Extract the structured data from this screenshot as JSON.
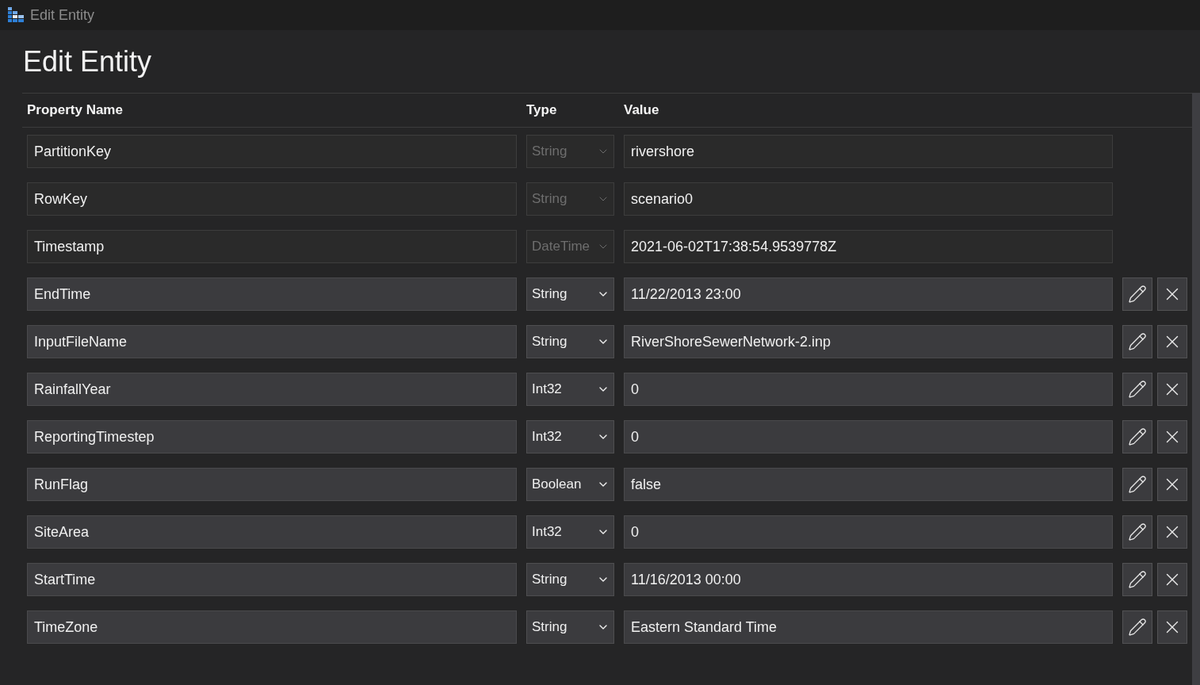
{
  "window": {
    "title": "Edit Entity"
  },
  "heading": "Edit Entity",
  "table": {
    "columns": [
      "Property Name",
      "Type",
      "Value"
    ],
    "rows": [
      {
        "name": "PartitionKey",
        "type": "String",
        "value": "rivershore",
        "disabled": true
      },
      {
        "name": "RowKey",
        "type": "String",
        "value": "scenario0",
        "disabled": true
      },
      {
        "name": "Timestamp",
        "type": "DateTime",
        "value": "2021-06-02T17:38:54.9539778Z",
        "disabled": true
      },
      {
        "name": "EndTime",
        "type": "String",
        "value": "11/22/2013 23:00",
        "disabled": false
      },
      {
        "name": "InputFileName",
        "type": "String",
        "value": "RiverShoreSewerNetwork-2.inp",
        "disabled": false
      },
      {
        "name": "RainfallYear",
        "type": "Int32",
        "value": "0",
        "disabled": false
      },
      {
        "name": "ReportingTimestep",
        "type": "Int32",
        "value": "0",
        "disabled": false
      },
      {
        "name": "RunFlag",
        "type": "Boolean",
        "value": "false",
        "disabled": false
      },
      {
        "name": "SiteArea",
        "type": "Int32",
        "value": "0",
        "disabled": false
      },
      {
        "name": "StartTime",
        "type": "String",
        "value": "11/16/2013 00:00",
        "disabled": false
      },
      {
        "name": "TimeZone",
        "type": "String",
        "value": "Eastern Standard Time",
        "disabled": false
      }
    ]
  }
}
